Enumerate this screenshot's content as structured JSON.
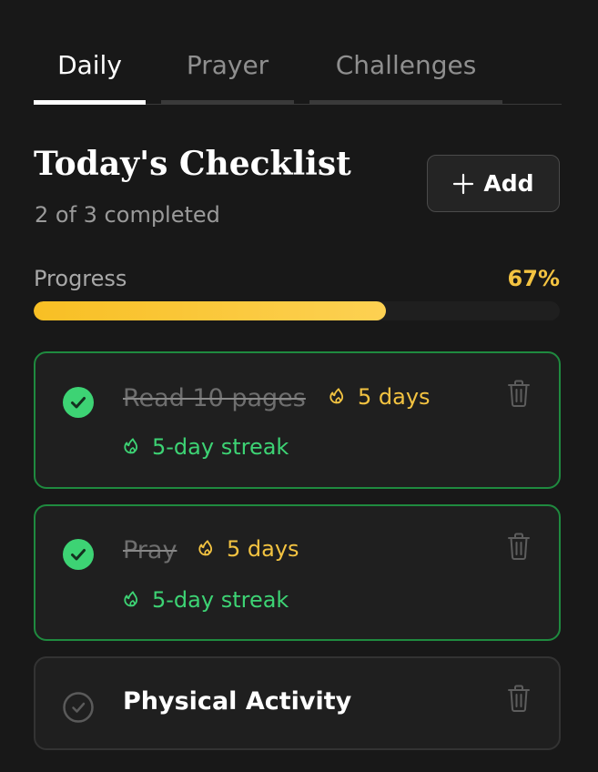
{
  "tabs": [
    {
      "label": "Daily",
      "active": true
    },
    {
      "label": "Prayer",
      "active": false
    },
    {
      "label": "Challenges",
      "active": false
    }
  ],
  "header": {
    "title": "Today's Checklist",
    "subtitle": "2 of 3 completed",
    "add_button": {
      "icon": "plus-icon",
      "label": "Add"
    }
  },
  "progress": {
    "label": "Progress",
    "value_text": "67%",
    "fraction": 0.67
  },
  "checklist": [
    {
      "name": "Read 10 pages",
      "completed": true,
      "days": "5 days",
      "streak": "5-day streak"
    },
    {
      "name": "Pray",
      "completed": true,
      "days": "5 days",
      "streak": "5-day streak"
    },
    {
      "name": "Physical Activity",
      "completed": false
    }
  ],
  "icons": {
    "check_done": "check-circle-filled-icon",
    "check_todo": "check-circle-outline-icon",
    "flame": "flame-icon",
    "delete": "trash-icon"
  },
  "colors": {
    "background": "#181818",
    "card": "#1f1f1f",
    "accent_yellow": "#f3c341",
    "accent_green": "#3dd374",
    "done_border": "#1f8a3f"
  }
}
